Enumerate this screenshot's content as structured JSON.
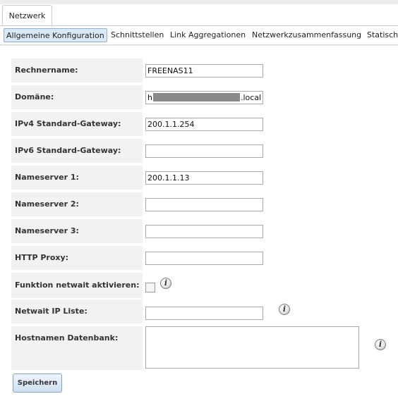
{
  "tabs": {
    "main": "Netzwerk"
  },
  "subtabs": [
    {
      "label": "Allgemeine Konfiguration",
      "active": true
    },
    {
      "label": "Schnittstellen"
    },
    {
      "label": "Link Aggregationen"
    },
    {
      "label": "Netzwerkzusammenfassung"
    },
    {
      "label": "Statisch"
    }
  ],
  "form": {
    "hostname": {
      "label": "Rechnername:",
      "value": "FREENAS11"
    },
    "domain": {
      "label": "Domäne:",
      "prefix": "h",
      "suffix": ".local"
    },
    "ipv4_gateway": {
      "label": "IPv4 Standard-Gateway:",
      "value": "200.1.1.254"
    },
    "ipv6_gateway": {
      "label": "IPv6 Standard-Gateway:",
      "value": ""
    },
    "nameserver1": {
      "label": "Nameserver 1:",
      "value": "200.1.1.13"
    },
    "nameserver2": {
      "label": "Nameserver 2:",
      "value": ""
    },
    "nameserver3": {
      "label": "Nameserver 3:",
      "value": ""
    },
    "http_proxy": {
      "label": "HTTP Proxy:",
      "value": ""
    },
    "netwait_enable": {
      "label": "Funktion netwait aktivieren:",
      "checked": false
    },
    "netwait_ips": {
      "label": "Netwait IP Liste:",
      "value": ""
    },
    "host_db": {
      "label": "Hostnamen Datenbank:",
      "value": ""
    }
  },
  "buttons": {
    "save": "Speichern"
  },
  "icons": {
    "info": "info-icon"
  }
}
